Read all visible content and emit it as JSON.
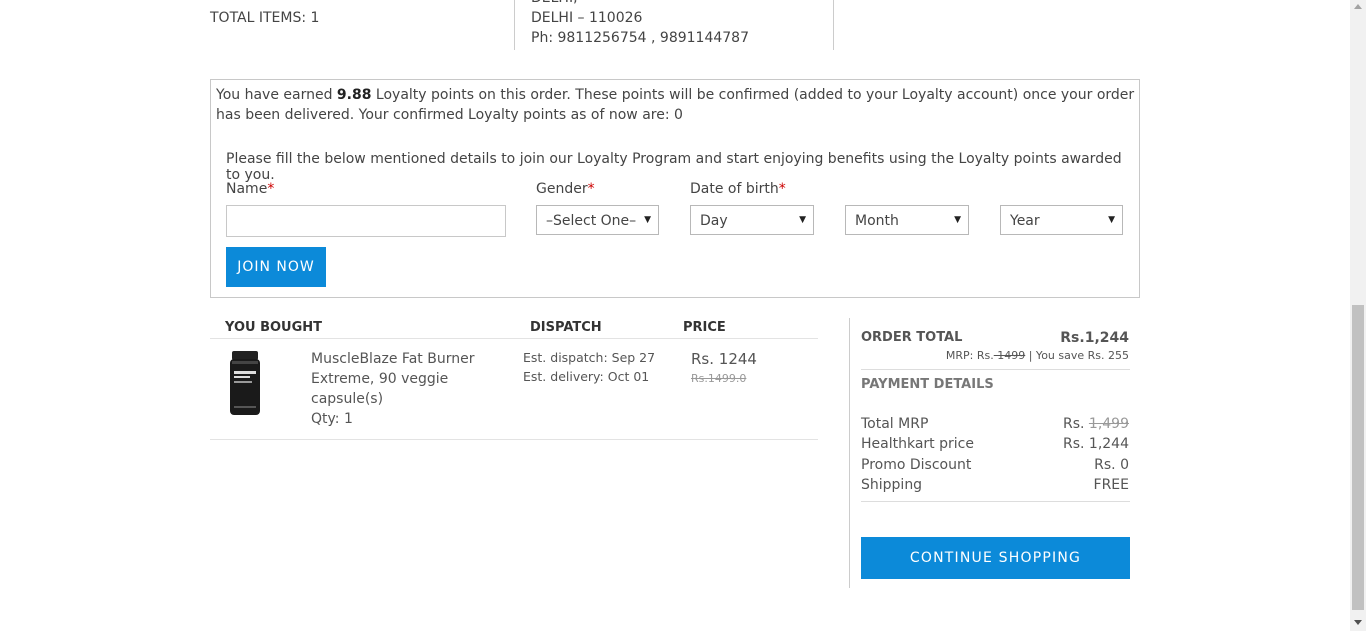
{
  "summary": {
    "total_items": "TOTAL ITEMS: 1",
    "address_city_partial": "DELHI,",
    "address_pin": "DELHI – 110026",
    "address_phone": "Ph: 9811256754 , 9891144787"
  },
  "loyalty": {
    "earned_prefix": "You have earned ",
    "earned_points": "9.88",
    "earned_suffix": " Loyalty points on this order. These points will be confirmed (added to your Loyalty account) once your order has been delivered. Your confirmed Loyalty points as of now are: 0",
    "join_text": "Please fill the below mentioned details to join our Loyalty Program and start enjoying benefits using the Loyalty points awarded to you.",
    "name_label": "Name",
    "gender_label": "Gender",
    "dob_label": "Date of birth",
    "required_mark": "*",
    "name_value": "",
    "gender_select": "–Select One–",
    "day_select": "Day",
    "month_select": "Month",
    "year_select": "Year",
    "join_button": "JOIN NOW"
  },
  "order_table": {
    "headers": [
      "YOU BOUGHT",
      "DISPATCH",
      "PRICE"
    ],
    "items": [
      {
        "name": "MuscleBlaze Fat Burner Extreme, 90 veggie capsule(s)",
        "qty": "Qty: 1",
        "dispatch": "Est. dispatch: Sep 27",
        "delivery": "Est. delivery: Oct 01",
        "price": "Rs. 1244",
        "old_price": "Rs.1499.0"
      }
    ]
  },
  "summary_panel": {
    "order_total_label": "ORDER TOTAL",
    "order_total_value": "Rs.1,244",
    "mrp_prefix": "MRP: Rs.",
    "mrp_value": " 1499",
    "save_text": " | You save Rs. 255",
    "payment_details_label": "PAYMENT DETAILS",
    "rows": [
      {
        "label": "Total MRP",
        "prefix": "Rs. ",
        "value": "1,499"
      },
      {
        "label": "Healthkart price",
        "value": "Rs. 1,244"
      },
      {
        "label": "Promo Discount",
        "value": "Rs. 0"
      },
      {
        "label": "Shipping",
        "value": "FREE"
      }
    ],
    "continue_button": "CONTINUE SHOPPING"
  },
  "colors": {
    "accent": "#0c8ad9",
    "required": "#cc0000"
  }
}
